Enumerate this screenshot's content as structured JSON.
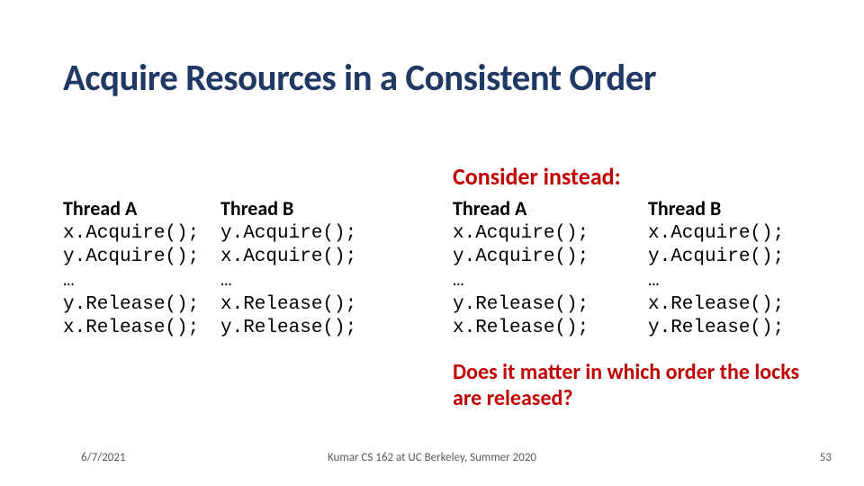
{
  "title": "Acquire Resources in a Consistent Order",
  "subhead": "Consider instead:",
  "left": {
    "threadA": {
      "label": "Thread A",
      "code": "x.Acquire();\ny.Acquire();\n…\ny.Release();\nx.Release();"
    },
    "threadB": {
      "label": "Thread B",
      "code": "y.Acquire();\nx.Acquire();\n…\nx.Release();\ny.Release();"
    }
  },
  "right": {
    "threadA": {
      "label": "Thread A",
      "code": "x.Acquire();\ny.Acquire();\n…\ny.Release();\nx.Release();"
    },
    "threadB": {
      "label": "Thread B",
      "code": "x.Acquire();\ny.Acquire();\n…\nx.Release();\ny.Release();"
    }
  },
  "question": "Does it matter in which order the locks are released?",
  "footer": {
    "date": "6/7/2021",
    "center": "Kumar CS 162 at UC Berkeley, Summer 2020",
    "num": "53"
  }
}
